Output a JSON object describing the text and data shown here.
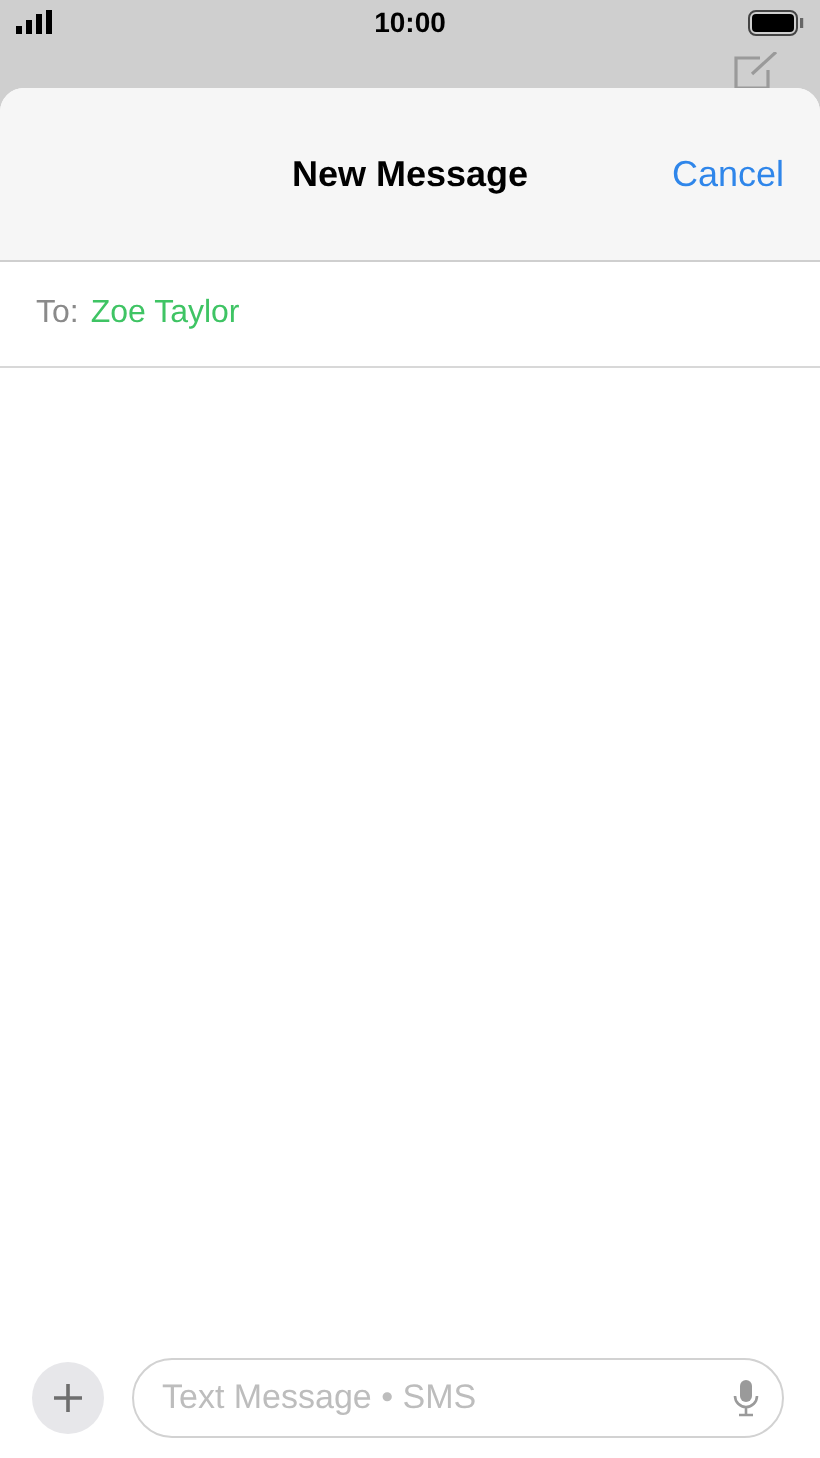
{
  "status_bar": {
    "time": "10:00"
  },
  "sheet": {
    "title": "New Message",
    "cancel": "Cancel"
  },
  "to_field": {
    "label": "To:",
    "recipient": "Zoe Taylor"
  },
  "composer": {
    "placeholder": "Text Message • SMS"
  }
}
